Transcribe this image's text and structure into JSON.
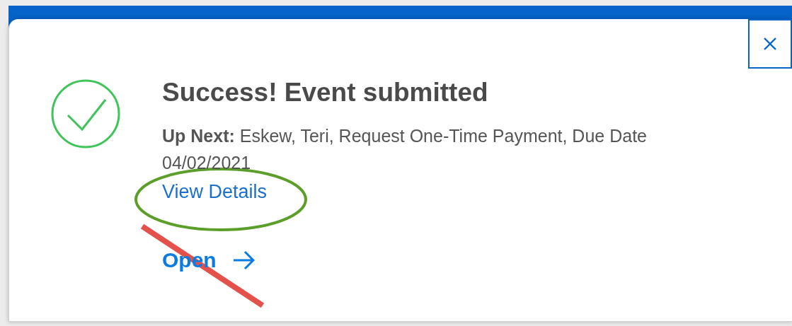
{
  "toast": {
    "kind": "success",
    "title": "Success! Event submitted",
    "message": "**Up Next:** Eskew, Teri, Request One-Time Payment, Due Date 04/02/2021",
    "link": "View Details",
    "action": "Open"
  }
}
